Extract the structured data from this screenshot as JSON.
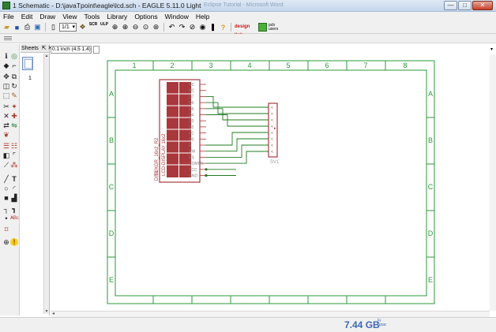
{
  "window": {
    "title": "1 Schematic - D:\\javaTpoint\\eagle\\lcd.sch - EAGLE 5.11.0 Light",
    "background_title": "Eclipse Tutorial - Microsoft Word",
    "minimize": "—",
    "maximize": "□",
    "close": "✕"
  },
  "menu": [
    "File",
    "Edit",
    "Draw",
    "View",
    "Tools",
    "Library",
    "Options",
    "Window",
    "Help"
  ],
  "toolbar": {
    "sheet_select": "1/1",
    "scr_label": "SCR",
    "ulp_label": "ULP",
    "signal_label": "design link",
    "pcb_label": "pcb users"
  },
  "sheets": {
    "title": "Sheets",
    "pin_icon": "pin-icon",
    "close_icon": "close-icon",
    "items": [
      "1"
    ]
  },
  "coordinate_readout": "0.1 inch (4.5 1.4)",
  "frame": {
    "columns": [
      "1",
      "2",
      "3",
      "4",
      "5",
      "6",
      "7",
      "8"
    ],
    "rows": [
      "A",
      "B",
      "C",
      "D",
      "E"
    ]
  },
  "lcd": {
    "name": "DIS1",
    "value_lines": [
      "LCD-DISPLAY 16x2",
      "TUXGR_16x2_R2"
    ],
    "pins": [
      "NC",
      "NC",
      "D7",
      "D6",
      "D5",
      "D4",
      "D3",
      "D2",
      "D1",
      "D0",
      "E",
      "RW",
      "RS",
      "CONTR.",
      "VCC",
      "GND"
    ]
  },
  "connector": {
    "name": "SV1",
    "pin_count": 8
  },
  "status": {
    "free_space": "7.44 GB",
    "free_label_1": "Fr",
    "free_label_2": "Spac"
  },
  "colors": {
    "frame": "#2a9a3a",
    "part": "#a8383c",
    "net": "#1f7a1f",
    "pin_text": "#7d7d7d"
  }
}
